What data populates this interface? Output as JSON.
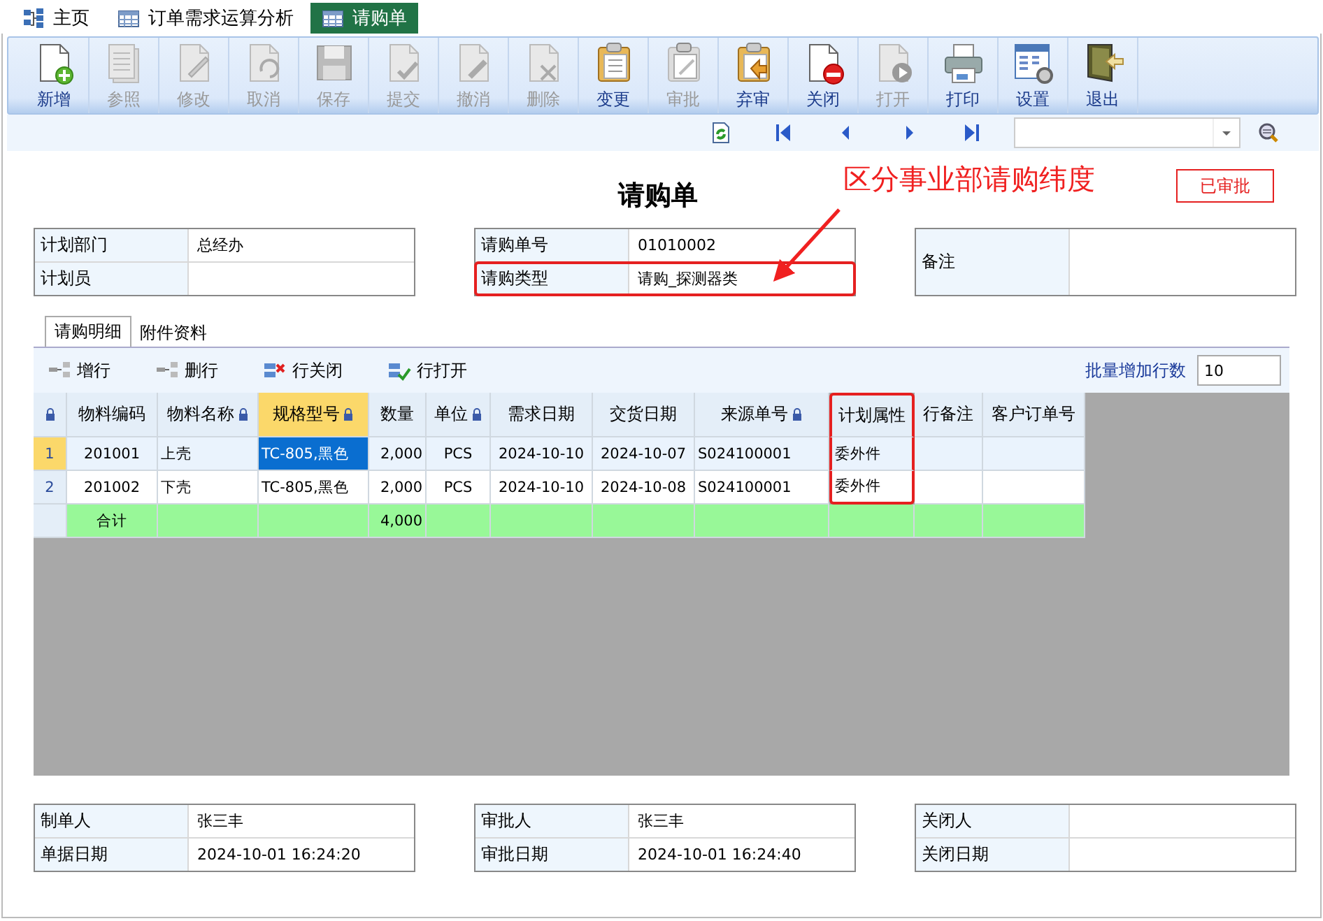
{
  "tabs": [
    {
      "label": "主页",
      "selected": false
    },
    {
      "label": "订单需求运算分析",
      "selected": false
    },
    {
      "label": "请购单",
      "selected": true
    }
  ],
  "toolbar": [
    {
      "label": "新增",
      "disabled": false
    },
    {
      "label": "参照",
      "disabled": true
    },
    {
      "label": "修改",
      "disabled": true
    },
    {
      "label": "取消",
      "disabled": true
    },
    {
      "label": "保存",
      "disabled": true
    },
    {
      "label": "提交",
      "disabled": true
    },
    {
      "label": "撤消",
      "disabled": true
    },
    {
      "label": "删除",
      "disabled": true
    },
    {
      "label": "变更",
      "disabled": false
    },
    {
      "label": "审批",
      "disabled": true
    },
    {
      "label": "弃审",
      "disabled": false
    },
    {
      "label": "关闭",
      "disabled": false
    },
    {
      "label": "打开",
      "disabled": true
    },
    {
      "label": "打印",
      "disabled": false
    },
    {
      "label": "设置",
      "disabled": false
    },
    {
      "label": "退出",
      "disabled": false
    }
  ],
  "title": "请购单",
  "annotation": "区分事业部请购纬度",
  "status_stamp": "已审批",
  "header_blocks": [
    {
      "fields": [
        {
          "label": "计划部门",
          "value": "总经办",
          "highlighted": false
        },
        {
          "label": "计划员",
          "highlighted": false
        }
      ]
    },
    {
      "fields": [
        {
          "label": "请购单号",
          "value": "01010002",
          "highlighted": false
        },
        {
          "label": "请购类型",
          "value": "请购_探测器类",
          "highlighted": true
        }
      ]
    },
    {
      "fields": [
        {
          "label": "备注",
          "highlighted": false
        }
      ]
    }
  ],
  "detail_tabs": [
    {
      "label": "请购明细",
      "selected": true
    },
    {
      "label": "附件资料",
      "selected": false
    }
  ],
  "grid_toolbar": {
    "buttons": [
      "增行",
      "删行",
      "行关闭",
      "行打开"
    ],
    "batch_label": "批量增加行数",
    "batch_value": "10"
  },
  "grid": {
    "corner_locked": true,
    "columns": [
      {
        "label": "物料编码",
        "locked": false,
        "selected": false,
        "highlighted": false
      },
      {
        "label": "物料名称",
        "locked": true,
        "selected": false,
        "highlighted": false
      },
      {
        "label": "规格型号",
        "locked": true,
        "selected": true,
        "highlighted": false
      },
      {
        "label": "数量",
        "locked": false,
        "selected": false,
        "highlighted": false
      },
      {
        "label": "单位",
        "locked": true,
        "selected": false,
        "highlighted": false
      },
      {
        "label": "需求日期",
        "locked": false,
        "selected": false,
        "highlighted": false
      },
      {
        "label": "交货日期",
        "locked": false,
        "selected": false,
        "highlighted": false
      },
      {
        "label": "来源单号",
        "locked": true,
        "selected": false,
        "highlighted": false
      },
      {
        "label": "计划属性",
        "locked": false,
        "selected": false,
        "highlighted": true
      },
      {
        "label": "行备注",
        "locked": false,
        "selected": false,
        "highlighted": false
      },
      {
        "label": "客户订单号",
        "locked": false,
        "selected": false,
        "highlighted": false
      }
    ],
    "rows": [
      {
        "number": "1",
        "selected": true,
        "cells": [
          "201001",
          "上壳",
          "TC-805,黑色",
          "2,000",
          "PCS",
          "2024-10-10",
          "2024-10-07",
          "S024100001",
          "委外件"
        ]
      },
      {
        "number": "2",
        "selected": false,
        "cells": [
          "201002",
          "下壳",
          "TC-805,黑色",
          "2,000",
          "PCS",
          "2024-10-10",
          "2024-10-08",
          "S024100001",
          "委外件"
        ]
      }
    ],
    "total_row": {
      "label": "合计",
      "quantity": "4,000"
    }
  },
  "footer_blocks": [
    {
      "fields": [
        {
          "label": "制单人",
          "value": "张三丰",
          "highlighted": false
        },
        {
          "label": "单据日期",
          "value": "2024-10-01 16:24:20",
          "highlighted": false
        }
      ]
    },
    {
      "fields": [
        {
          "label": "审批人",
          "value": "张三丰",
          "highlighted": false
        },
        {
          "label": "审批日期",
          "value": "2024-10-01 16:24:40",
          "highlighted": false
        }
      ]
    },
    {
      "fields": [
        {
          "label": "关闭人",
          "highlighted": false
        },
        {
          "label": "关闭日期",
          "highlighted": false
        }
      ]
    }
  ]
}
